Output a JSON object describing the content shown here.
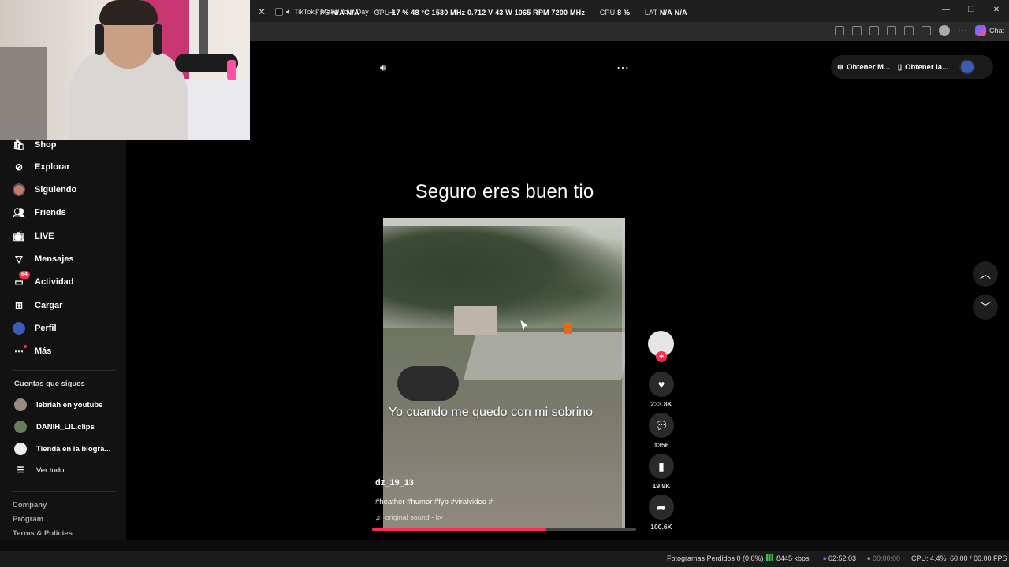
{
  "browser": {
    "tab_title": "TikTok - Make Your Day",
    "overlay": {
      "fps_label": "FPS",
      "fps_value": "N/A",
      "fps_value2": "N/A",
      "gpu_label": "GPU",
      "gpu_usage": "17 %",
      "gpu_temp": "48 °C",
      "gpu_clock": "1530 MHz",
      "gpu_voltage": "0.712 V",
      "gpu_power": "43 W",
      "gpu_fan": "1065 RPM",
      "gpu_mem": "7200 MHz",
      "cpu_label": "CPU",
      "cpu_usage": "8 %",
      "lat_label": "LAT",
      "lat_value": "N/A",
      "lat_value2": "N/A"
    },
    "chat_label": "Chat"
  },
  "sidebar": {
    "items": [
      {
        "label": "Shop",
        "icon": "shop-icon"
      },
      {
        "label": "Explorar",
        "icon": "compass-icon"
      },
      {
        "label": "Siguiendo",
        "icon": "following-avatar-icon"
      },
      {
        "label": "Friends",
        "icon": "friends-icon"
      },
      {
        "label": "LIVE",
        "icon": "live-icon"
      },
      {
        "label": "Mensajes",
        "icon": "send-icon"
      },
      {
        "label": "Actividad",
        "icon": "activity-icon",
        "badge": "64"
      },
      {
        "label": "Cargar",
        "icon": "upload-icon"
      },
      {
        "label": "Perfil",
        "icon": "profile-avatar-icon"
      },
      {
        "label": "Más",
        "icon": "more-icon"
      }
    ],
    "following_title": "Cuentas que sigues",
    "following": [
      {
        "name": "Iebriah en youtube"
      },
      {
        "name": "DANIH_LIL.clips"
      },
      {
        "name": "Tienda en la biogra..."
      }
    ],
    "see_all": "Ver todo",
    "footer": [
      "Company",
      "Program",
      "Terms & Policies"
    ]
  },
  "main": {
    "top_actions": [
      "Obtener M...",
      "Obtener la..."
    ],
    "title": "Seguro eres buen tio",
    "video": {
      "caption": "Yo cuando me quedo con mi sobrino",
      "username": "dz_19_13",
      "tags": "#heather #humor #fyp #viralvideo #",
      "sound": "original sound - ky",
      "progress": 0.66
    },
    "actions": {
      "likes": "233.8K",
      "comments": "1356",
      "saves": "19.9K",
      "shares": "100.6K"
    }
  },
  "statusbar": {
    "dropped_frames": "Fotogramas Perdidos 0 (0.0%)",
    "bitrate": "8445 kbps",
    "stream_time": "02:52:03",
    "rec_time": "00:00:00",
    "cpu": "CPU: 4.4%",
    "fps": "60.00 / 60.00 FPS"
  },
  "colors": {
    "accent": "#fe2c55",
    "background": "#000000",
    "sidebar_bg": "#121212"
  }
}
